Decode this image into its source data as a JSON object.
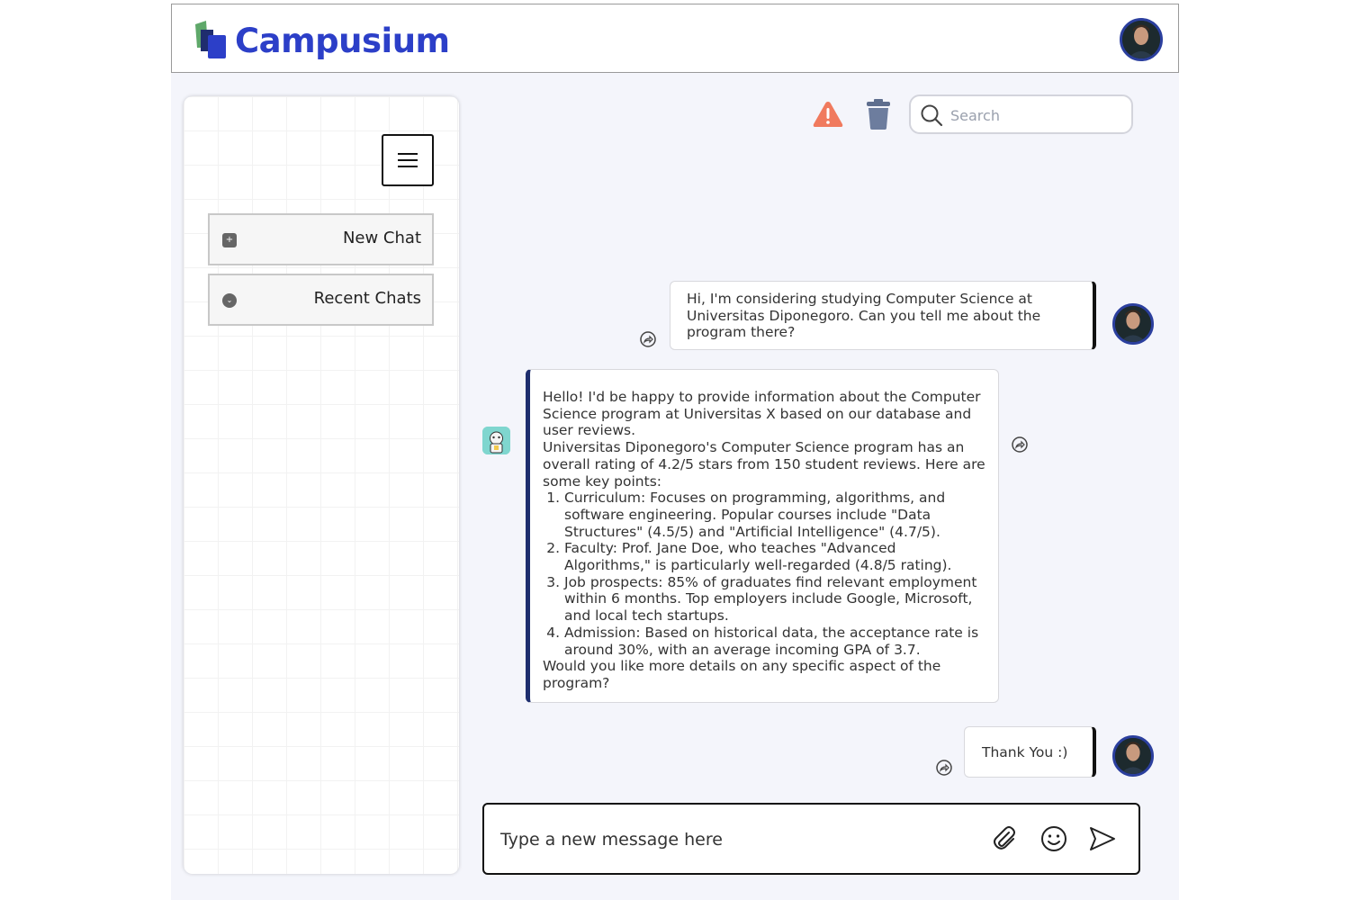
{
  "app": {
    "name": "Campusium"
  },
  "colors": {
    "brand": "#2c3fc8",
    "warning": "#f08060",
    "trash": "#6a7a9a",
    "bot_accent": "#1e2e6e"
  },
  "header": {
    "logo_text": "Campusium",
    "avatar_icon": "user-avatar"
  },
  "sidebar": {
    "menu_icon": "hamburger-icon",
    "items": [
      {
        "label": "New Chat",
        "icon": "plus-square-icon"
      },
      {
        "label": "Recent Chats",
        "icon": "chevron-down-circle-icon"
      }
    ]
  },
  "toolbar": {
    "report_icon": "warning-icon",
    "delete_icon": "trash-icon",
    "search": {
      "placeholder": "Search",
      "value": ""
    }
  },
  "messages": [
    {
      "from": "user",
      "text": "Hi, I'm considering studying Computer Science at Universitas Diponegoro. Can you tell me about the program there?"
    },
    {
      "from": "bot",
      "intro1": "Hello! I'd be happy to provide information about the Computer Science program at Universitas X based on our database and user reviews.",
      "intro2": "Universitas Diponegoro's Computer Science program has an overall rating of 4.2/5 stars from 150 student reviews. Here are some key points:",
      "points": [
        "Curriculum: Focuses on programming, algorithms, and software engineering. Popular courses include \"Data Structures\" (4.5/5) and \"Artificial Intelligence\" (4.7/5).",
        "Faculty: Prof. Jane Doe, who teaches \"Advanced Algorithms,\" is particularly well-regarded (4.8/5 rating).",
        "Job prospects: 85% of graduates find relevant employment within 6 months. Top employers include Google, Microsoft, and local tech startups.",
        "Admission: Based on historical data, the acceptance rate is around 30%, with an average incoming GPA of 3.7."
      ],
      "outro": "Would you like more details on any specific aspect of the program?"
    },
    {
      "from": "user",
      "text": "Thank You :)"
    }
  ],
  "composer": {
    "placeholder": "Type a new message here",
    "attach_icon": "paperclip-icon",
    "emoji_icon": "smiley-icon",
    "send_icon": "send-icon"
  }
}
